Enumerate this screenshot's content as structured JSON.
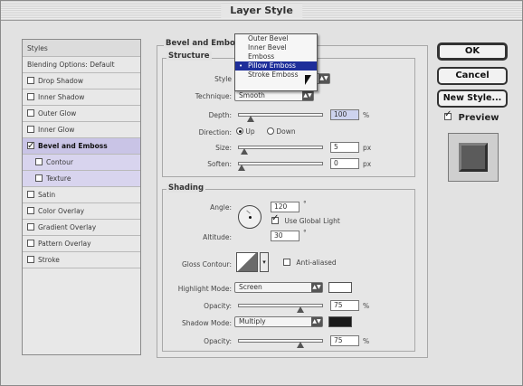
{
  "window": {
    "title": "Layer Style"
  },
  "sidebar": {
    "items": [
      {
        "label": "Styles",
        "checkbox": false,
        "checked": false
      },
      {
        "label": "Blending Options: Default",
        "checkbox": false,
        "checked": false
      },
      {
        "label": "Drop Shadow",
        "checkbox": true,
        "checked": false
      },
      {
        "label": "Inner Shadow",
        "checkbox": true,
        "checked": false
      },
      {
        "label": "Outer Glow",
        "checkbox": true,
        "checked": false
      },
      {
        "label": "Inner Glow",
        "checkbox": true,
        "checked": false
      },
      {
        "label": "Bevel and Emboss",
        "checkbox": true,
        "checked": true
      },
      {
        "label": "Contour",
        "checkbox": true,
        "checked": false
      },
      {
        "label": "Texture",
        "checkbox": true,
        "checked": false
      },
      {
        "label": "Satin",
        "checkbox": true,
        "checked": false
      },
      {
        "label": "Color Overlay",
        "checkbox": true,
        "checked": false
      },
      {
        "label": "Gradient Overlay",
        "checkbox": true,
        "checked": false
      },
      {
        "label": "Pattern Overlay",
        "checkbox": true,
        "checked": false
      },
      {
        "label": "Stroke",
        "checkbox": true,
        "checked": false
      }
    ]
  },
  "bevel": {
    "group_title": "Bevel and Embo",
    "structure_title": "Structure",
    "style_label": "Style",
    "technique_label": "Technique:",
    "technique_value": "Smooth",
    "depth_label": "Depth:",
    "depth_value": "100",
    "depth_unit": "%",
    "depth_level": 0.12,
    "direction_label": "Direction:",
    "direction_up": "Up",
    "direction_down": "Down",
    "size_label": "Size:",
    "size_value": "5",
    "size_unit": "px",
    "size_level": 0.03,
    "soften_label": "Soften:",
    "soften_value": "0",
    "soften_unit": "px",
    "soften_level": 0.0
  },
  "style_menu": {
    "items": [
      "Outer Bevel",
      "Inner Bevel",
      "Emboss",
      "Pillow Emboss",
      "Stroke Emboss"
    ],
    "selected_index": 3
  },
  "shading": {
    "title": "Shading",
    "angle_label": "Angle:",
    "angle_value": "120",
    "angle_unit": "°",
    "global_light_label": "Use Global Light",
    "altitude_label": "Altitude:",
    "altitude_value": "30",
    "altitude_unit": "°",
    "gloss_label": "Gloss Contour:",
    "anti_aliased_label": "Anti-aliased",
    "highlight_mode_label": "Highlight Mode:",
    "highlight_mode_value": "Screen",
    "highlight_color": "#ffffff",
    "highlight_opacity_label": "Opacity:",
    "highlight_opacity_value": "75",
    "highlight_opacity_unit": "%",
    "highlight_opacity_level": 0.75,
    "shadow_mode_label": "Shadow Mode:",
    "shadow_mode_value": "Multiply",
    "shadow_color": "#1a1a1a",
    "shadow_opacity_label": "Opacity:",
    "shadow_opacity_value": "75",
    "shadow_opacity_unit": "%",
    "shadow_opacity_level": 0.75
  },
  "buttons": {
    "ok": "OK",
    "cancel": "Cancel",
    "new_style": "New Style...",
    "preview_label": "Preview"
  },
  "colors": {
    "selection_highlight": "#c9c4e6",
    "menu_highlight": "#1e2e9a"
  }
}
